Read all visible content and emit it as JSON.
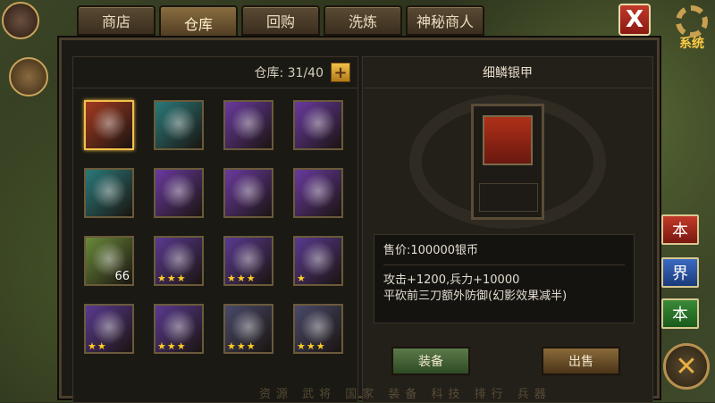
{
  "tabs": [
    {
      "label": "商店"
    },
    {
      "label": "仓库",
      "active": true
    },
    {
      "label": "回购"
    },
    {
      "label": "洗炼"
    },
    {
      "label": "神秘商人"
    }
  ],
  "close_label": "X",
  "system_label": "系统",
  "warehouse": {
    "count_label": "仓库: 31/40",
    "plus_label": "+"
  },
  "items": [
    {
      "name": "armor-icon",
      "color": "#a33a20",
      "selected": true
    },
    {
      "name": "scroll-icon",
      "color": "#2a7a7a"
    },
    {
      "name": "ore-icon",
      "color": "#6a3aa0"
    },
    {
      "name": "ore-icon",
      "color": "#6a3aa0"
    },
    {
      "name": "blade-icon",
      "color": "#2a7a7a"
    },
    {
      "name": "scroll-bundle-icon",
      "color": "#6a3aa0"
    },
    {
      "name": "scroll-bundle-icon",
      "color": "#6a3aa0"
    },
    {
      "name": "scroll-bundle-icon",
      "color": "#6a3aa0"
    },
    {
      "name": "stone-icon",
      "color": "#6a8a3a",
      "qty": "66"
    },
    {
      "name": "axe-icon",
      "color": "#5a3a90",
      "stars": "★★★"
    },
    {
      "name": "axe-icon",
      "color": "#5a3a90",
      "stars": "★★★"
    },
    {
      "name": "axe-icon",
      "color": "#5a3a90",
      "stars": "★"
    },
    {
      "name": "axe-icon",
      "color": "#5a3a90",
      "stars": "★★"
    },
    {
      "name": "axe-icon",
      "color": "#5a3a90",
      "stars": "★★★"
    },
    {
      "name": "horse-icon",
      "color": "#4a4a6a",
      "stars": "★★★"
    },
    {
      "name": "horse-icon",
      "color": "#4a4a6a",
      "stars": "★★★"
    }
  ],
  "detail": {
    "title": "细鳞银甲",
    "price": "售价:100000银币",
    "stats": "攻击+1200,兵力+10000",
    "effect": "平砍前三刀额外防御(幻影效果减半)"
  },
  "buttons": {
    "equip": "装备",
    "sell": "出售"
  },
  "side_buttons": [
    "本",
    "界",
    "本"
  ],
  "bottom_nav": "资源 武将 国家 装备 科技 排行 兵器"
}
